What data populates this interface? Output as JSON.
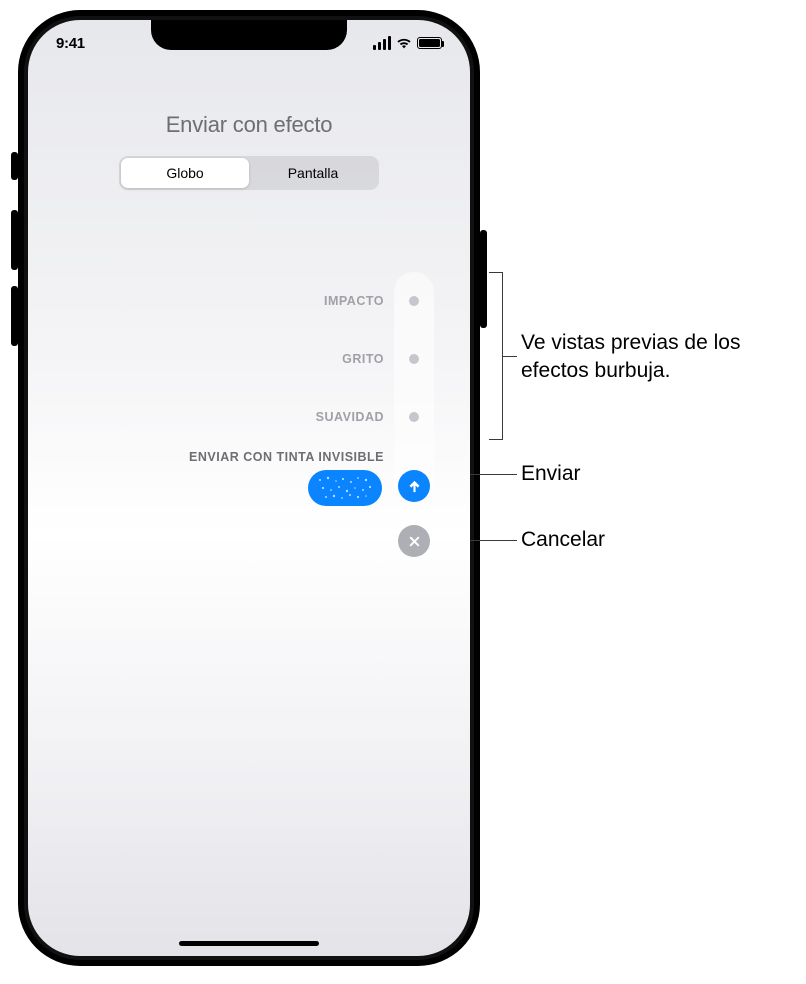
{
  "status": {
    "time": "9:41"
  },
  "header": {
    "title": "Enviar con efecto",
    "tabs": [
      {
        "label": "Globo",
        "active": true
      },
      {
        "label": "Pantalla",
        "active": false
      }
    ]
  },
  "effects": {
    "items": [
      {
        "label": "IMPACTO"
      },
      {
        "label": "GRITO"
      },
      {
        "label": "SUAVIDAD"
      }
    ],
    "selected_label": "ENVIAR CON TINTA INVISIBLE"
  },
  "callouts": {
    "preview": "Ve vistas previas de los efectos burbuja.",
    "send": "Enviar",
    "cancel": "Cancelar"
  }
}
